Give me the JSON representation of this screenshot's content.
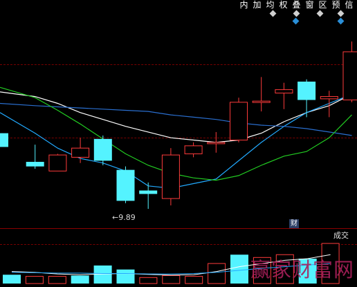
{
  "toolbar": {
    "buttons": [
      {
        "id": "nei",
        "label": "内"
      },
      {
        "id": "jia",
        "label": "加"
      },
      {
        "id": "jun",
        "label": "均"
      },
      {
        "id": "quan",
        "label": "权"
      },
      {
        "id": "die",
        "label": "叠"
      },
      {
        "id": "chuang",
        "label": "窗"
      },
      {
        "id": "qu",
        "label": "区"
      },
      {
        "id": "yu",
        "label": "预"
      },
      {
        "id": "xin",
        "label": "信"
      }
    ]
  },
  "chart": {
    "low_price_label": "←9.89",
    "info_badge": "财",
    "volume_label": "成交",
    "watermark": "赢家财富网"
  },
  "colors": {
    "up": "#ff3b3b",
    "down": "#54f3ff",
    "ma_white": "#ffffff",
    "ma_cyan": "#22aaff",
    "ma_blue": "#2a6fd0",
    "ma_green": "#22cc22",
    "grid": "#7a0000",
    "background": "#000000"
  },
  "chart_data": {
    "type": "candlestick",
    "y_label_shown": "9.89",
    "candles": [
      {
        "dir": "down",
        "open": 0.66,
        "close": 0.54,
        "high": 0.66,
        "low": 0.54
      },
      {
        "dir": "down",
        "open": 0.41,
        "close": 0.37,
        "high": 0.56,
        "low": 0.35
      },
      {
        "dir": "up",
        "open": 0.33,
        "close": 0.47,
        "high": 0.48,
        "low": 0.33
      },
      {
        "dir": "up",
        "open": 0.45,
        "close": 0.53,
        "high": 0.62,
        "low": 0.4
      },
      {
        "dir": "down",
        "open": 0.61,
        "close": 0.42,
        "high": 0.64,
        "low": 0.38
      },
      {
        "dir": "down",
        "open": 0.34,
        "close": 0.07,
        "high": 0.37,
        "low": 0.05
      },
      {
        "dir": "down",
        "open": 0.16,
        "close": 0.13,
        "high": 0.23,
        "low": 0.0
      },
      {
        "dir": "up",
        "open": 0.09,
        "close": 0.47,
        "high": 0.53,
        "low": 0.03
      },
      {
        "dir": "up",
        "open": 0.48,
        "close": 0.55,
        "high": 0.58,
        "low": 0.45
      },
      {
        "dir": "up",
        "open": 0.58,
        "close": 0.58,
        "high": 0.67,
        "low": 0.49
      },
      {
        "dir": "up",
        "open": 0.6,
        "close": 0.93,
        "high": 0.97,
        "low": 0.58
      },
      {
        "dir": "up",
        "open": 0.94,
        "close": 0.94,
        "high": 1.15,
        "low": 0.85
      },
      {
        "dir": "up",
        "open": 1.01,
        "close": 1.04,
        "high": 1.1,
        "low": 0.87
      },
      {
        "dir": "down",
        "open": 1.11,
        "close": 0.95,
        "high": 1.13,
        "low": 0.8
      },
      {
        "dir": "up",
        "open": 0.96,
        "close": 0.98,
        "high": 1.03,
        "low": 0.8
      },
      {
        "dir": "up",
        "open": 0.95,
        "close": 1.37,
        "high": 1.46,
        "low": 0.93
      }
    ],
    "moving_averages": [
      {
        "color_key": "ma_white",
        "values": [
          1.02,
          0.98,
          0.92,
          0.84,
          0.78,
          0.72,
          0.67,
          0.62,
          0.6,
          0.58,
          0.6,
          0.66,
          0.76,
          0.84,
          0.9,
          1.0
        ]
      },
      {
        "color_key": "ma_cyan",
        "values": [
          0.84,
          0.66,
          0.53,
          0.44,
          0.4,
          0.33,
          0.2,
          0.18,
          0.22,
          0.26,
          0.42,
          0.58,
          0.72,
          0.84,
          0.92,
          1.0
        ]
      },
      {
        "color_key": "ma_blue",
        "values": [
          0.92,
          0.9,
          0.89,
          0.88,
          0.87,
          0.86,
          0.85,
          0.82,
          0.8,
          0.78,
          0.75,
          0.73,
          0.72,
          0.7,
          0.67,
          0.64
        ]
      },
      {
        "color_key": "ma_green",
        "values": [
          1.06,
          0.97,
          0.86,
          0.74,
          0.61,
          0.48,
          0.38,
          0.31,
          0.27,
          0.25,
          0.29,
          0.38,
          0.46,
          0.5,
          0.62,
          0.82
        ]
      }
    ],
    "volumes": [
      {
        "dir": "down",
        "value": 0.22
      },
      {
        "dir": "up",
        "value": 0.18
      },
      {
        "dir": "up",
        "value": 0.18
      },
      {
        "dir": "down",
        "value": 0.2
      },
      {
        "dir": "down",
        "value": 0.45
      },
      {
        "dir": "down",
        "value": 0.35
      },
      {
        "dir": "up",
        "value": 0.15
      },
      {
        "dir": "up",
        "value": 0.2
      },
      {
        "dir": "up",
        "value": 0.18
      },
      {
        "dir": "up",
        "value": 0.5
      },
      {
        "dir": "down",
        "value": 0.72
      },
      {
        "dir": "up",
        "value": 0.65
      },
      {
        "dir": "up",
        "value": 0.72
      },
      {
        "dir": "down",
        "value": 0.62
      },
      {
        "dir": "up",
        "value": 1.0
      }
    ],
    "volume_ma": [
      {
        "color_key": "ma_white",
        "values": [
          0.3,
          0.28,
          0.24,
          0.22,
          0.24,
          0.25,
          0.23,
          0.21,
          0.22,
          0.3,
          0.42,
          0.5,
          0.58,
          0.62,
          0.72
        ]
      },
      {
        "color_key": "ma_cyan",
        "values": [
          0.28,
          0.27,
          0.26,
          0.26,
          0.25,
          0.25,
          0.24,
          0.24,
          0.25,
          0.28,
          0.33,
          0.38,
          0.42,
          0.46,
          0.5
        ]
      }
    ]
  }
}
